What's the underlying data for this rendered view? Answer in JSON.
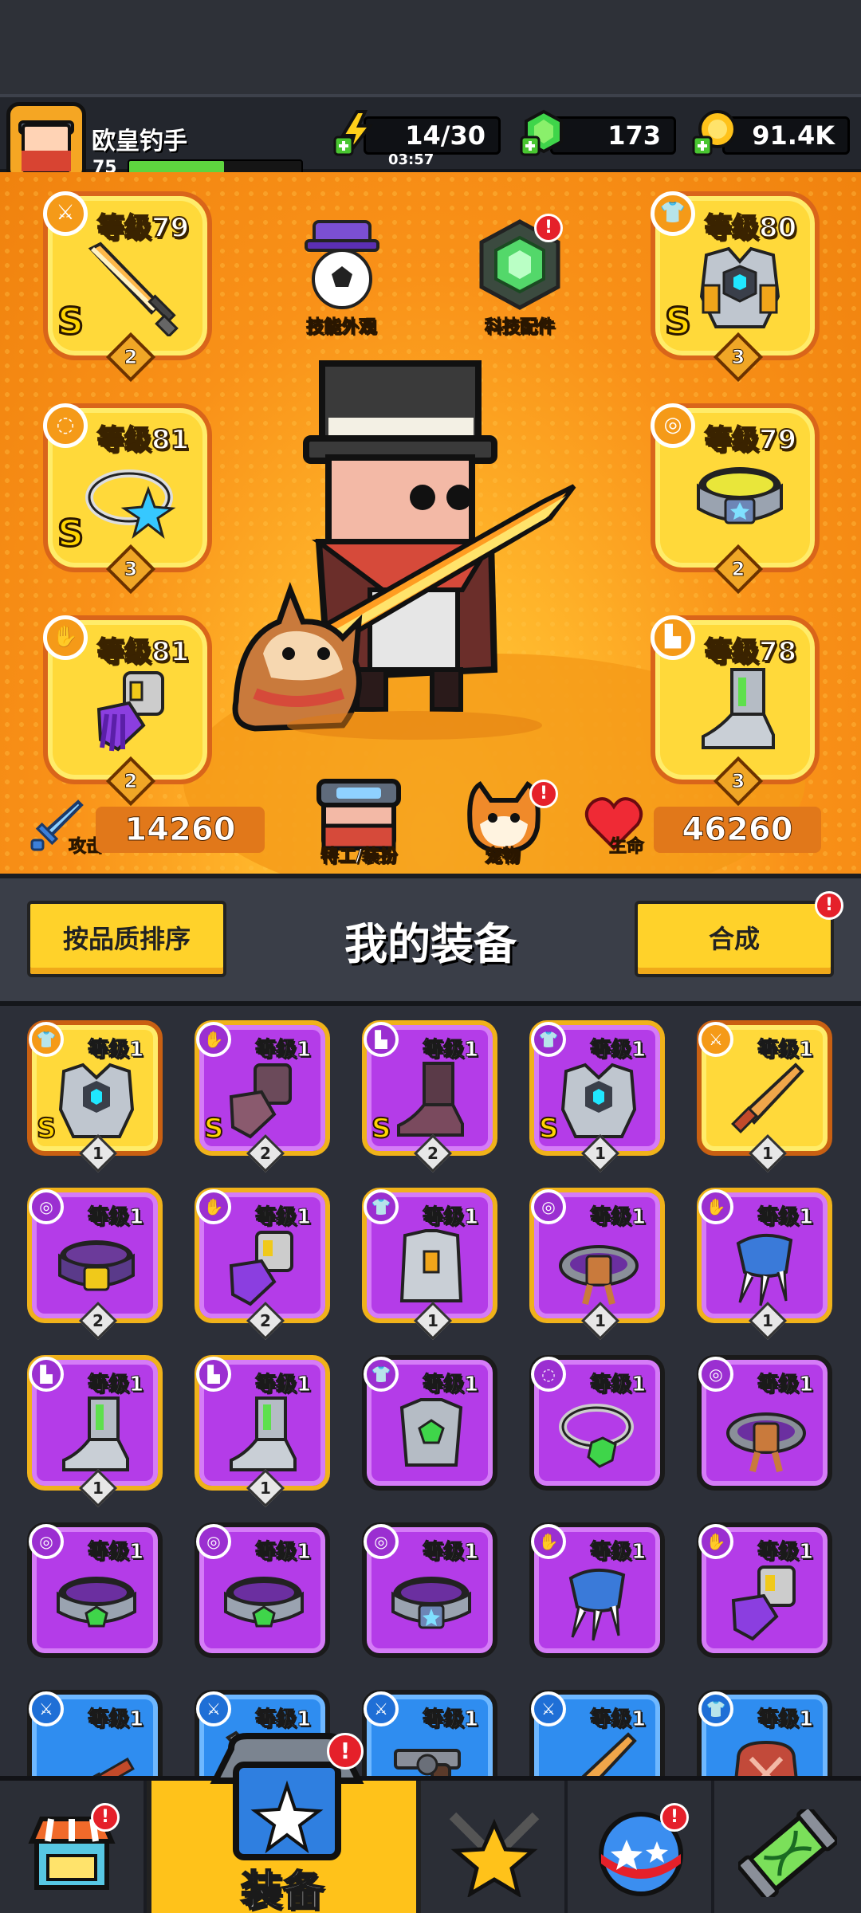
{
  "header": {
    "player_name": "欧皇钓手",
    "player_level": "75",
    "xp_fraction": 0.55,
    "energy": "14/30",
    "energy_timer": "03:57",
    "gems": "173",
    "gold": "91.4K"
  },
  "hero": {
    "left_slots": [
      {
        "level": "等级79",
        "rank": "S",
        "stars": "2",
        "type_icon": "weapon-icon",
        "item": "sword"
      },
      {
        "level": "等级81",
        "rank": "S",
        "stars": "3",
        "type_icon": "necklace-icon",
        "item": "star-necklace"
      },
      {
        "level": "等级81",
        "rank": "",
        "stars": "2",
        "type_icon": "glove-icon",
        "item": "gauntlet"
      }
    ],
    "right_slots": [
      {
        "level": "等级80",
        "rank": "S",
        "stars": "3",
        "type_icon": "armor-icon",
        "item": "robot-armor"
      },
      {
        "level": "等级79",
        "rank": "",
        "stars": "2",
        "type_icon": "belt-icon",
        "item": "belt"
      },
      {
        "level": "等级78",
        "rank": "",
        "stars": "3",
        "type_icon": "boot-icon",
        "item": "boots"
      }
    ],
    "skill_skin_label": "技能外观",
    "tech_parts_label": "科技配件",
    "agent_label": "特工/装扮",
    "pet_label": "宠物",
    "attack_label": "攻击",
    "attack_value": "14260",
    "hp_label": "生命",
    "hp_value": "46260",
    "badge": "!"
  },
  "equipment": {
    "sort_label": "按品质排序",
    "title": "我的装备",
    "merge_label": "合成",
    "items": [
      {
        "level": "等级1",
        "rank": "S",
        "stars": "1",
        "color": "gold",
        "type": "armor",
        "art": "robot-armor"
      },
      {
        "level": "等级1",
        "rank": "S",
        "stars": "2",
        "color": "goldborder",
        "type": "glove",
        "art": "dark-gauntlet"
      },
      {
        "level": "等级1",
        "rank": "S",
        "stars": "2",
        "color": "goldborder",
        "type": "boot",
        "art": "dark-boot"
      },
      {
        "level": "等级1",
        "rank": "S",
        "stars": "1",
        "color": "goldborder",
        "type": "armor",
        "art": "robot-armor"
      },
      {
        "level": "等级1",
        "rank": "",
        "stars": "1",
        "color": "gold",
        "type": "weapon",
        "art": "bat"
      },
      {
        "level": "等级1",
        "rank": "",
        "stars": "2",
        "color": "goldborder",
        "type": "belt",
        "art": "belt"
      },
      {
        "level": "等级1",
        "rank": "",
        "stars": "2",
        "color": "goldborder",
        "type": "glove",
        "art": "gauntlet"
      },
      {
        "level": "等级1",
        "rank": "",
        "stars": "1",
        "color": "goldborder",
        "type": "armor",
        "art": "vest"
      },
      {
        "level": "等级1",
        "rank": "",
        "stars": "1",
        "color": "goldborder",
        "type": "belt",
        "art": "rope-belt"
      },
      {
        "level": "等级1",
        "rank": "",
        "stars": "1",
        "color": "goldborder",
        "type": "glove",
        "art": "claw"
      },
      {
        "level": "等级1",
        "rank": "",
        "stars": "1",
        "color": "goldborder",
        "type": "boot",
        "art": "boot"
      },
      {
        "level": "等级1",
        "rank": "",
        "stars": "1",
        "color": "goldborder",
        "type": "boot",
        "art": "boot"
      },
      {
        "level": "等级1",
        "rank": "",
        "stars": "",
        "color": "purple",
        "type": "armor",
        "art": "gem-armor"
      },
      {
        "level": "等级1",
        "rank": "",
        "stars": "",
        "color": "purple",
        "type": "necklace",
        "art": "gem-necklace"
      },
      {
        "level": "等级1",
        "rank": "",
        "stars": "",
        "color": "purple",
        "type": "belt",
        "art": "rope-belt"
      },
      {
        "level": "等级1",
        "rank": "",
        "stars": "",
        "color": "purple",
        "type": "belt",
        "art": "gem-belt"
      },
      {
        "level": "等级1",
        "rank": "",
        "stars": "",
        "color": "purple",
        "type": "belt",
        "art": "gem-belt"
      },
      {
        "level": "等级1",
        "rank": "",
        "stars": "",
        "color": "purple",
        "type": "belt",
        "art": "blue-belt"
      },
      {
        "level": "等级1",
        "rank": "",
        "stars": "",
        "color": "purple",
        "type": "glove",
        "art": "claw"
      },
      {
        "level": "等级1",
        "rank": "",
        "stars": "",
        "color": "purple",
        "type": "glove",
        "art": "gauntlet"
      },
      {
        "level": "等级1",
        "rank": "",
        "stars": "",
        "color": "blue",
        "type": "weapon",
        "art": "kunai"
      },
      {
        "level": "等级1",
        "rank": "",
        "stars": "",
        "color": "blue",
        "type": "weapon",
        "art": "sword"
      },
      {
        "level": "等级1",
        "rank": "",
        "stars": "",
        "color": "blue",
        "type": "weapon",
        "art": "revolver"
      },
      {
        "level": "等级1",
        "rank": "",
        "stars": "",
        "color": "blue",
        "type": "weapon",
        "art": "bat"
      },
      {
        "level": "等级1",
        "rank": "",
        "stars": "",
        "color": "blue",
        "type": "armor",
        "art": "bag"
      }
    ]
  },
  "nav": {
    "shop_icon": "shop-icon",
    "equipment_label": "装备",
    "battle_icon": "crossed-swords-star-icon",
    "gacha_icon": "gacha-ball-icon",
    "lab_icon": "dna-capsule-icon"
  },
  "colors": {
    "hero_bg": "#f99118",
    "slot_gold": "#ffd93a",
    "card_purple": "#b43ce8",
    "card_blue": "#2f8df0",
    "accent_yellow": "#ffd22a",
    "badge_red": "#e5202a"
  }
}
